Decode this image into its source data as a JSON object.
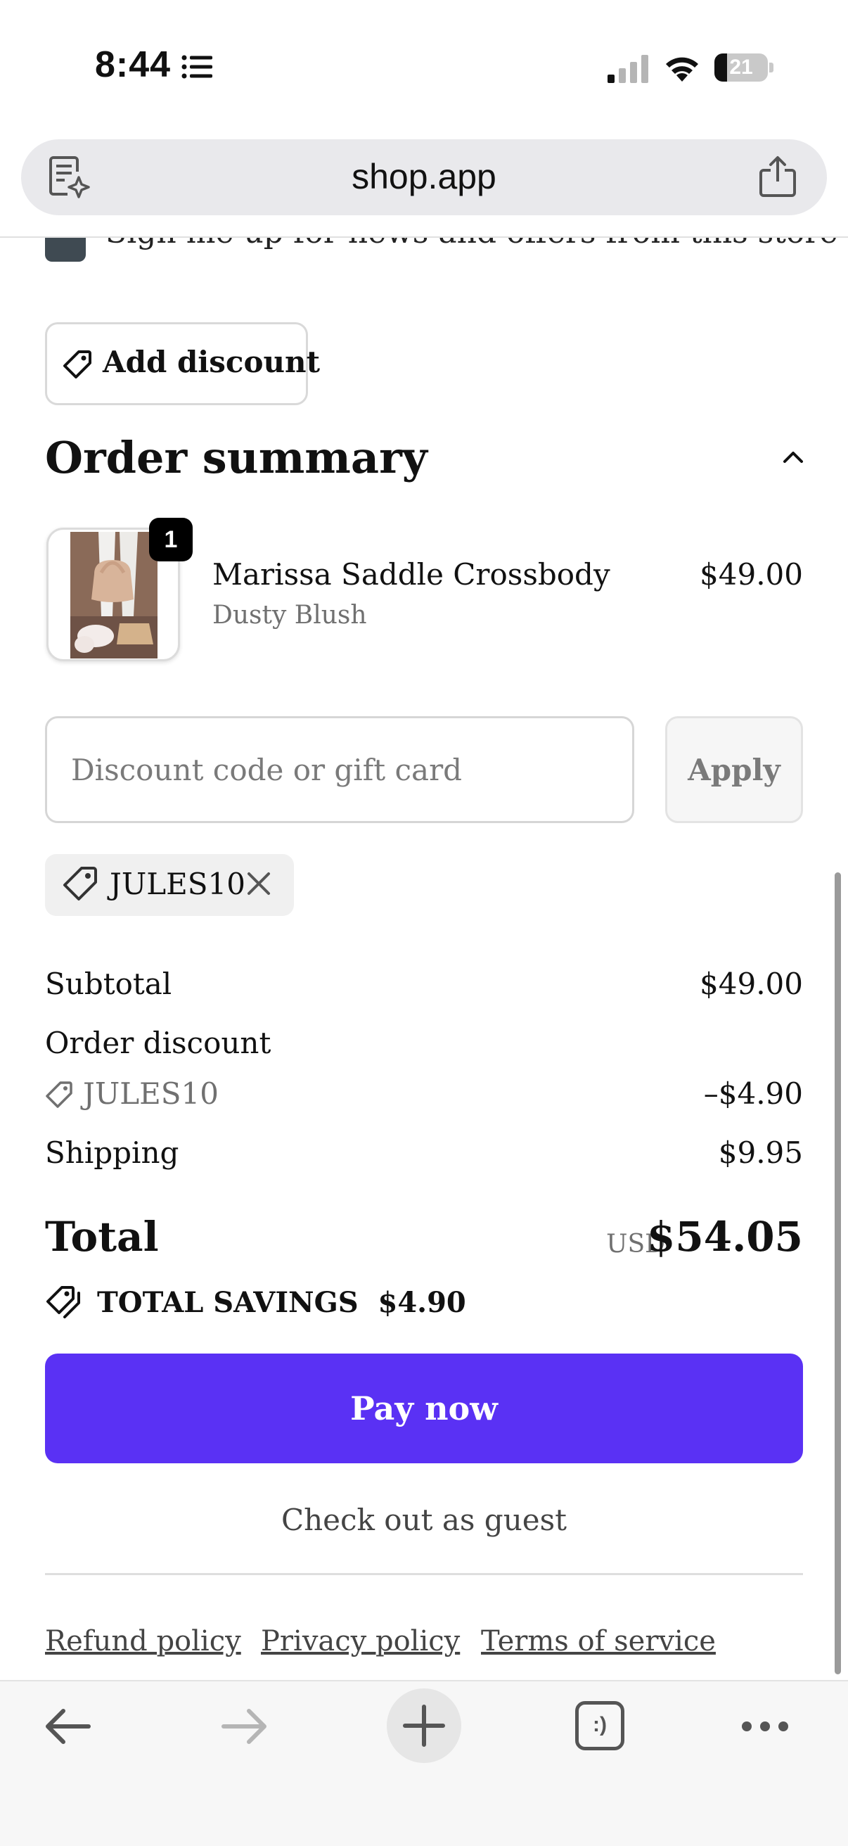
{
  "status_bar": {
    "time": "8:44",
    "battery": "21"
  },
  "browser": {
    "url": "shop.app"
  },
  "newsletter": {
    "label": "Sign me up for news and offers from this store"
  },
  "discount": {
    "add_label": "Add discount",
    "input_placeholder": "Discount code or gift card",
    "apply_label": "Apply",
    "applied_code": "JULES10"
  },
  "order_summary": {
    "title": "Order summary",
    "item": {
      "quantity": "1",
      "name": "Marissa Saddle Crossbody",
      "variant": "Dusty Blush",
      "price": "$49.00"
    }
  },
  "totals": {
    "subtotal_label": "Subtotal",
    "subtotal_value": "$49.00",
    "order_discount_label": "Order discount",
    "discount_code": "JULES10",
    "discount_value": "–$4.90",
    "shipping_label": "Shipping",
    "shipping_value": "$9.95",
    "total_label": "Total",
    "currency": "USD",
    "total_value": "$54.05",
    "savings_label": "TOTAL SAVINGS",
    "savings_value": "$4.90"
  },
  "actions": {
    "pay_now": "Pay now",
    "guest_checkout": "Check out as guest"
  },
  "footer": {
    "links": [
      "Refund policy",
      "Privacy policy",
      "Terms of service"
    ]
  },
  "toolbar": {
    "tabs_glyph": ":)"
  },
  "colors": {
    "pay_button": "#5a31f4",
    "checkbox": "#3f4a52"
  }
}
